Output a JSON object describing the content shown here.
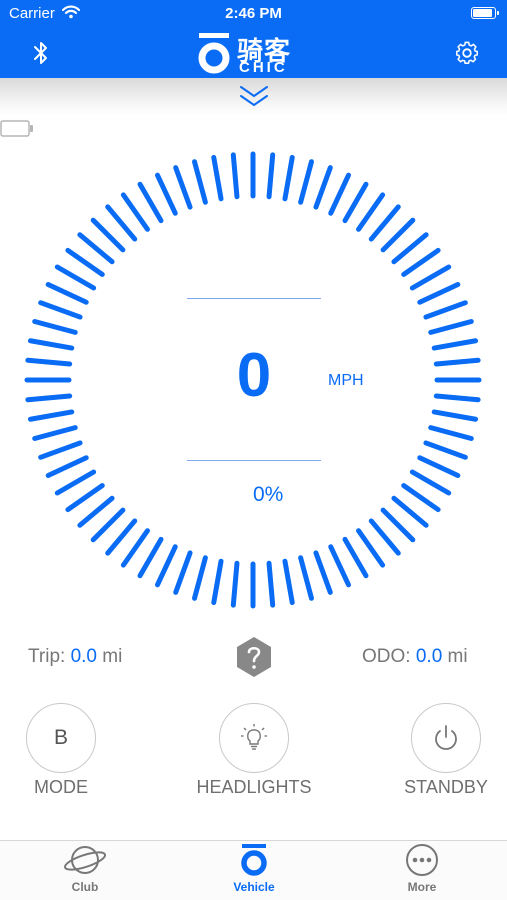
{
  "status_bar": {
    "carrier": "Carrier",
    "time": "2:46 PM"
  },
  "header": {
    "logo_cn": "骑客",
    "logo_en": "CHIC"
  },
  "gauge": {
    "speed": "0",
    "unit": "MPH",
    "battery_percent": "0%",
    "tick_count": 72
  },
  "stats": {
    "trip_label": "Trip:",
    "trip_value": "0.0",
    "trip_unit": "mi",
    "odo_label": "ODO:",
    "odo_value": "0.0",
    "odo_unit": "mi"
  },
  "controls": {
    "mode_value": "B",
    "mode_label": "MODE",
    "headlights_label": "HEADLIGHTS",
    "standby_label": "STANDBY"
  },
  "tabs": [
    {
      "label": "Club",
      "icon": "planet-icon"
    },
    {
      "label": "Vehicle",
      "icon": "vehicle-icon",
      "active": true
    },
    {
      "label": "More",
      "icon": "more-icon"
    }
  ],
  "colors": {
    "accent": "#0a6cf5",
    "muted": "#777777"
  }
}
